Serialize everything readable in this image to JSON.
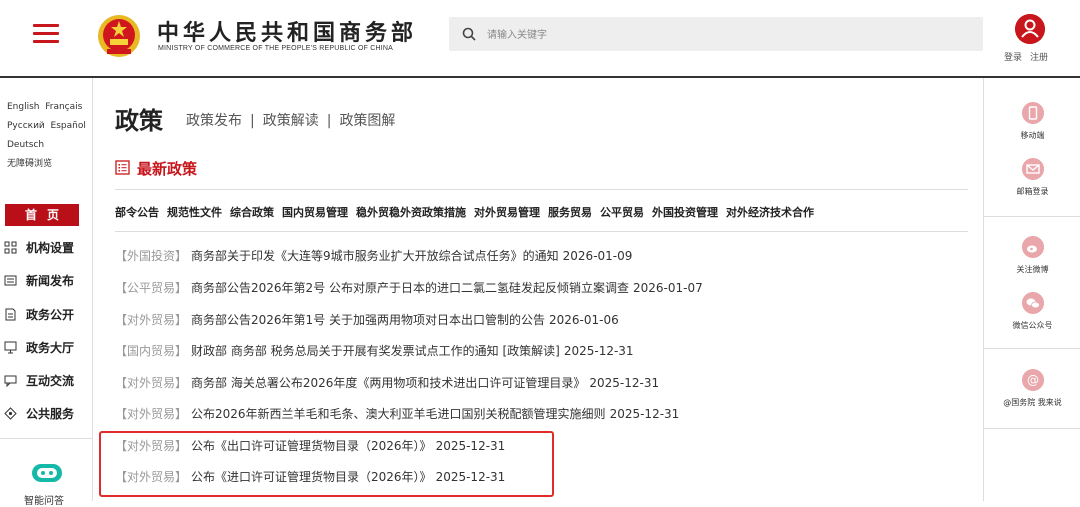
{
  "header": {
    "site_title": "中华人民共和国商务部",
    "site_subtitle": "MINISTRY OF COMMERCE OF THE PEOPLE'S REPUBLIC OF CHINA",
    "search_placeholder": "请输入关键字",
    "login_label": "登录",
    "register_label": "注册"
  },
  "left": {
    "languages": [
      "English",
      "Français",
      "Русский",
      "Español",
      "Deutsch"
    ],
    "accessibility": "无障碍浏览",
    "home_label": "首页",
    "nav": [
      {
        "label": "机构设置",
        "icon": "org-icon"
      },
      {
        "label": "新闻发布",
        "icon": "news-icon"
      },
      {
        "label": "政务公开",
        "icon": "document-icon"
      },
      {
        "label": "政务大厅",
        "icon": "monitor-icon"
      },
      {
        "label": "互动交流",
        "icon": "chat-icon"
      },
      {
        "label": "公共服务",
        "icon": "service-icon"
      }
    ],
    "ai_label": "智能问答"
  },
  "main": {
    "heading": "政策",
    "tabs": [
      "政策发布",
      "政策解读",
      "政策图解"
    ],
    "latest_label": "最新政策",
    "categories": [
      "部令公告",
      "规范性文件",
      "综合政策",
      "国内贸易管理",
      "稳外贸稳外资政策措施",
      "对外贸易管理",
      "服务贸易",
      "公平贸易",
      "外国投资管理",
      "对外经济技术合作"
    ],
    "news": [
      {
        "tag": "【外国投资】",
        "title": "商务部关于印发《大连等9城市服务业扩大开放综合试点任务》的通知",
        "date": "2026-01-09"
      },
      {
        "tag": "【公平贸易】",
        "title": "商务部公告2026年第2号 公布对原产于日本的进口二氯二氢硅发起反倾销立案调查",
        "date": "2026-01-07"
      },
      {
        "tag": "【对外贸易】",
        "title": "商务部公告2026年第1号 关于加强两用物项对日本出口管制的公告",
        "date": "2026-01-06"
      },
      {
        "tag": "【国内贸易】",
        "title": "财政部 商务部 税务总局关于开展有奖发票试点工作的通知 [政策解读]",
        "date": "2025-12-31"
      },
      {
        "tag": "【对外贸易】",
        "title": "商务部 海关总署公布2026年度《两用物项和技术进出口许可证管理目录》",
        "date": "2025-12-31"
      },
      {
        "tag": "【对外贸易】",
        "title": "公布2026年新西兰羊毛和毛条、澳大利亚羊毛进口国别关税配额管理实施细则",
        "date": "2025-12-31"
      },
      {
        "tag": "【对外贸易】",
        "title": "公布《出口许可证管理货物目录（2026年）》",
        "date": "2025-12-31"
      },
      {
        "tag": "【对外贸易】",
        "title": "公布《进口许可证管理货物目录（2026年）》",
        "date": "2025-12-31"
      }
    ]
  },
  "right": {
    "items": [
      {
        "label": "移动端",
        "icon": "mobile-icon"
      },
      {
        "label": "邮箱登录",
        "icon": "mail-icon"
      },
      {
        "label": "关注微博",
        "icon": "weibo-icon"
      },
      {
        "label": "微信公众号",
        "icon": "wechat-icon"
      },
      {
        "label": "@国务院 我来说",
        "icon": "at-icon"
      }
    ]
  },
  "colors": {
    "brand_red": "#c8161d",
    "highlight_border": "#e02b2b",
    "tag_gray": "#999999",
    "icon_pink": "#e9a7ab"
  }
}
